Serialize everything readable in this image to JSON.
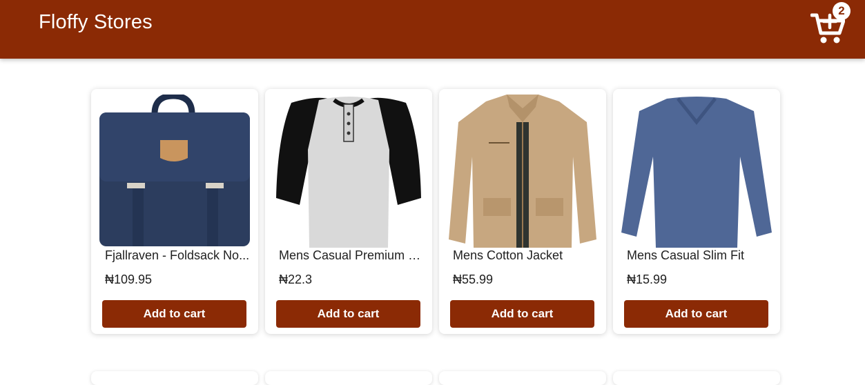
{
  "app": {
    "brand": "Floffy Stores"
  },
  "cart": {
    "count": "2"
  },
  "products": [
    {
      "title": "Fjallraven - Foldsack No...",
      "price": "₦109.95",
      "button": "Add to cart",
      "image": "backpack"
    },
    {
      "title": "Mens Casual Premium S...",
      "price": "₦22.3",
      "button": "Add to cart",
      "image": "raglan-tshirt"
    },
    {
      "title": "Mens Cotton Jacket",
      "price": "₦55.99",
      "button": "Add to cart",
      "image": "jacket"
    },
    {
      "title": "Mens Casual Slim Fit",
      "price": "₦15.99",
      "button": "Add to cart",
      "image": "long-sleeve-shirt"
    }
  ],
  "colors": {
    "accent": "#8b2a05",
    "background": "#ffffff"
  }
}
